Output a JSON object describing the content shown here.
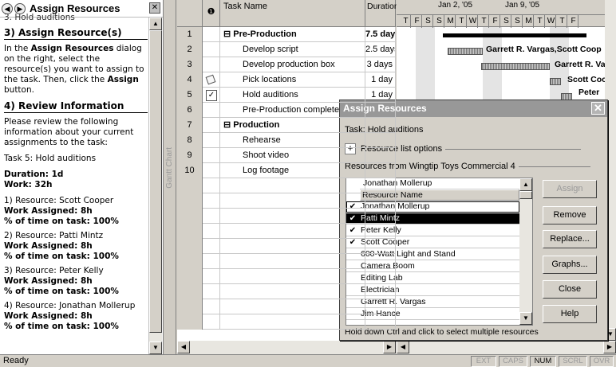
{
  "help": {
    "title": "Assign Resources",
    "cut_line": "3. Hold auditions",
    "sec3": "3) Assign Resource(s)",
    "p3_parts": [
      "In the ",
      "Assign Resources",
      " dialog on the right, select the resource(s) you want to assign to the task. Then, click the ",
      "Assign",
      " button."
    ],
    "sec4": "4) Review Information",
    "p4": "Please review the following information about your current assignments to the task:",
    "task_line": "Task 5: Hold auditions",
    "duration": "Duration: 1d",
    "work": "Work: 32h",
    "resources": [
      {
        "name": "1) Resource: Scott Cooper",
        "work": "Work Assigned: 8h",
        "pct": "% of time on task: 100%"
      },
      {
        "name": "2) Resource: Patti Mintz",
        "work": "Work Assigned: 8h",
        "pct": "% of time on task: 100%"
      },
      {
        "name": "3) Resource: Peter Kelly",
        "work": "Work Assigned: 8h",
        "pct": "% of time on task: 100%"
      },
      {
        "name": "4) Resource: Jonathan Mollerup",
        "work": "Work Assigned: 8h",
        "pct": "% of time on task: 100%"
      }
    ]
  },
  "gantt_side_label": "Gantt Chart",
  "table": {
    "col_ind": "❶",
    "col_name": "Task Name",
    "col_dur": "Duration",
    "rows": [
      {
        "id": "1",
        "name": "⊟ Pre-Production",
        "dur": "7.5 days",
        "summary": true
      },
      {
        "id": "2",
        "name": "Develop script",
        "dur": "2.5 days"
      },
      {
        "id": "3",
        "name": "Develop production box",
        "dur": "3 days"
      },
      {
        "id": "4",
        "name": "Pick locations",
        "dur": "1 day"
      },
      {
        "id": "5",
        "name": "Hold auditions",
        "dur": "1 day"
      },
      {
        "id": "6",
        "name": "Pre-Production complete",
        "dur": ""
      },
      {
        "id": "7",
        "name": "⊟ Production",
        "dur": "",
        "summary": true
      },
      {
        "id": "8",
        "name": "Rehearse",
        "dur": ""
      },
      {
        "id": "9",
        "name": "Shoot video",
        "dur": ""
      },
      {
        "id": "10",
        "name": "Log footage",
        "dur": ""
      }
    ]
  },
  "timescale": {
    "week1": "Jan 2, '05",
    "week2": "Jan 9, '05",
    "days": [
      "T",
      "F",
      "S",
      "S",
      "M",
      "T",
      "W",
      "T",
      "F",
      "S",
      "S",
      "M",
      "T",
      "W",
      "T",
      "F"
    ]
  },
  "bar_labels": {
    "r2": "Garrett R. Vargas,Scott Coop",
    "r3": "Garrett R. Va",
    "r4": "Scott Coc",
    "r5": "Peter"
  },
  "dialog": {
    "title": "Assign Resources",
    "task": "Task: Hold auditions",
    "options": "Resource list options",
    "from": "Resources from Wingtip Toys Commercial 4",
    "edit_value": "Jonathan Mollerup",
    "col_header": "Resource Name",
    "resources": [
      {
        "name": "Jonathan Mollerup",
        "checked": true
      },
      {
        "name": "Patti Mintz",
        "checked": true
      },
      {
        "name": "Peter Kelly",
        "checked": true
      },
      {
        "name": "Scott Cooper",
        "checked": true
      },
      {
        "name": "600-Watt Light and Stand",
        "checked": false
      },
      {
        "name": "Camera Boom",
        "checked": false
      },
      {
        "name": "Editing Lab",
        "checked": false
      },
      {
        "name": "Electrician",
        "checked": false
      },
      {
        "name": "Garrett R. Vargas",
        "checked": false
      },
      {
        "name": "Jim Hance",
        "checked": false
      }
    ],
    "hint": "Hold down Ctrl and click to select multiple resources",
    "buttons": {
      "assign": "Assign",
      "remove": "Remove",
      "replace": "Replace...",
      "graphs": "Graphs...",
      "close": "Close",
      "help": "Help"
    }
  },
  "status": {
    "text": "Ready",
    "indicators": [
      "EXT",
      "CAPS",
      "NUM",
      "SCRL",
      "OVR"
    ]
  }
}
